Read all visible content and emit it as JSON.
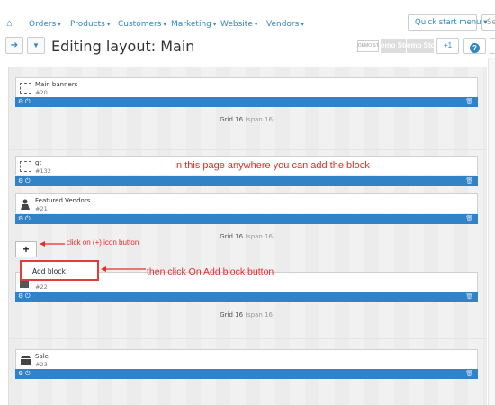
{
  "nav": {
    "home_icon": "home-icon",
    "menus": [
      {
        "label": "Orders"
      },
      {
        "label": "Products"
      },
      {
        "label": "Customers"
      },
      {
        "label": "Marketing"
      },
      {
        "label": "Website"
      },
      {
        "label": "Vendors"
      }
    ],
    "quick_start": "Quick start menu ▾",
    "search_placeholder": "Sea"
  },
  "toolbar": {
    "title": "Editing layout: Main",
    "demo_small": "DEMO STO",
    "demo_a": "emo Sto",
    "demo_b": "emo Sto",
    "plus_one": "+1",
    "help": "?"
  },
  "blocks": [
    {
      "title": "Main banners",
      "id": "#20"
    },
    {
      "title": "gt",
      "id": "#132"
    },
    {
      "title": "Featured Vendors",
      "id": "#21"
    },
    {
      "title": "",
      "id": "#22"
    },
    {
      "title": "Sale",
      "id": "#23"
    }
  ],
  "grids": [
    {
      "label": "Grid 16",
      "span": "(span 16)"
    },
    {
      "label": "Grid 16",
      "span": "(span 16)"
    },
    {
      "label": "Grid 16",
      "span": "(span 16)"
    }
  ],
  "annotations": {
    "anywhere": "In this page anywhere you can add the block",
    "click_plus": "click on (+) icon button",
    "then_click": "then click On Add block button"
  },
  "add_button": "+",
  "add_block": "Add block",
  "colors": {
    "accent": "#3182c6",
    "annotation": "#e82b2b",
    "canvas": "#f1f1f1"
  }
}
